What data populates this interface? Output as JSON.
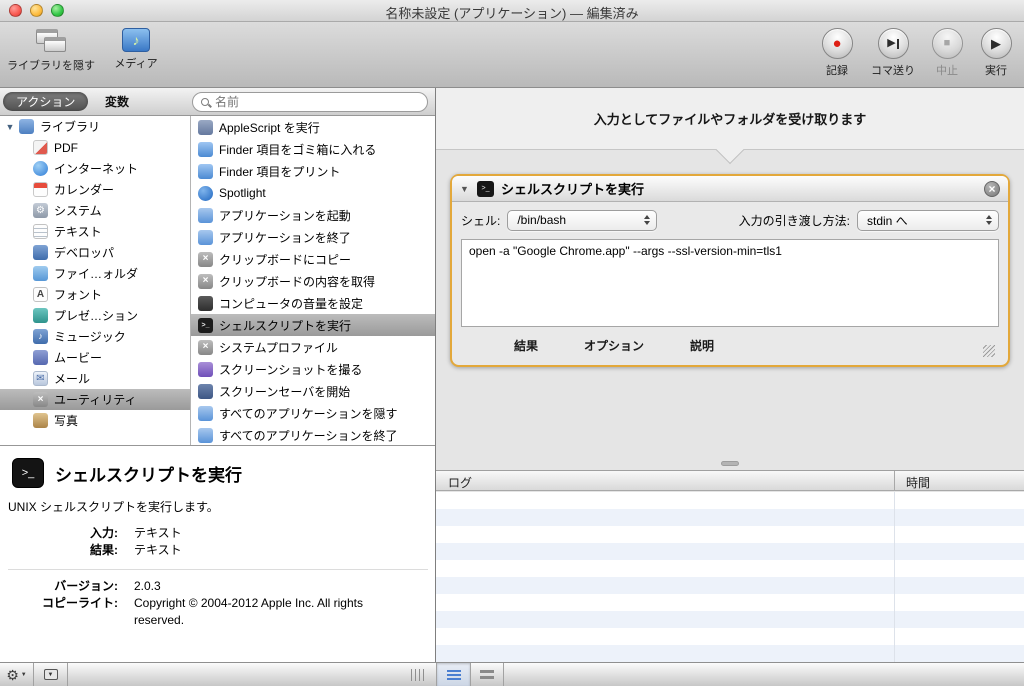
{
  "colors": {
    "accent_orange": "#E3A83A",
    "selection_gray": "#A7A7A7",
    "record_red": "#DE1F14"
  },
  "window": {
    "title": "名称未設定 (アプリケーション) — 編集済み"
  },
  "toolbar": {
    "hide_library_label": "ライブラリを隠す",
    "media_label": "メディア",
    "record_label": "記録",
    "step_label": "コマ送り",
    "stop_label": "中止",
    "run_label": "実行"
  },
  "tabs": {
    "actions_label": "アクション",
    "variables_label": "変数"
  },
  "search": {
    "placeholder": "名前"
  },
  "library": {
    "root_label": "ライブラリ",
    "items": [
      "PDF",
      "インターネット",
      "カレンダー",
      "システム",
      "テキスト",
      "デベロッパ",
      "ファイ…ォルダ",
      "フォント",
      "プレゼ…ション",
      "ミュージック",
      "ムービー",
      "メール",
      "ユーティリティ",
      "写真"
    ],
    "selected_item": "ユーティリティ"
  },
  "actions_list": {
    "items": [
      "AppleScript を実行",
      "Finder 項目をゴミ箱に入れる",
      "Finder 項目をプリント",
      "Spotlight",
      "アプリケーションを起動",
      "アプリケーションを終了",
      "クリップボードにコピー",
      "クリップボードの内容を取得",
      "コンピュータの音量を設定",
      "シェルスクリプトを実行",
      "システムプロファイル",
      "スクリーンショットを撮る",
      "スクリーンセーバを開始",
      "すべてのアプリケーションを隠す",
      "すべてのアプリケーションを終了"
    ],
    "selected_item": "シェルスクリプトを実行"
  },
  "description": {
    "title": "シェルスクリプトを実行",
    "summary": "UNIX シェルスクリプトを実行します。",
    "fields": [
      {
        "label": "入力:",
        "value": "テキスト"
      },
      {
        "label": "結果:",
        "value": "テキスト"
      }
    ],
    "meta": [
      {
        "label": "バージョン:",
        "value": "2.0.3"
      },
      {
        "label": "コピーライト:",
        "value": "Copyright © 2004-2012 Apple Inc.  All rights reserved."
      }
    ]
  },
  "workflow": {
    "input_hint": "入力としてファイルやフォルダを受け取ります",
    "action": {
      "title": "シェルスクリプトを実行",
      "shell_label": "シェル:",
      "shell_value": "/bin/bash",
      "pass_label": "入力の引き渡し方法:",
      "pass_value": "stdin へ",
      "script": "open -a \"Google Chrome.app\" --args --ssl-version-min=tls1",
      "footer_results": "結果",
      "footer_options": "オプション",
      "footer_description": "説明"
    },
    "log": {
      "log_header": "ログ",
      "time_header": "時間"
    }
  },
  "icons": {
    "gear": "⚙",
    "close": "×",
    "disclosure_down": "▼",
    "play": "▶",
    "stop_square": "■",
    "record_dot": "●",
    "music_note": "♪",
    "mail": "✉",
    "utility_x": "×",
    "font_a": "A",
    "terminal_prompt": ">_"
  }
}
